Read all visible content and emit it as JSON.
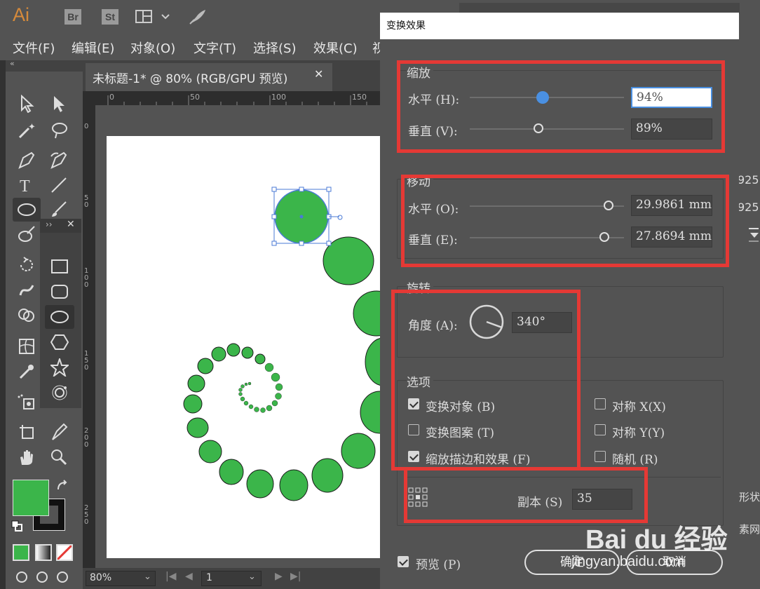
{
  "app": {
    "logo": "Ai",
    "bridge": "Br",
    "stock": "St",
    "menu": [
      "文件(F)",
      "编辑(E)",
      "对象(O)",
      "文字(T)",
      "选择(S)",
      "效果(C)",
      "视"
    ]
  },
  "document": {
    "tab_title": "未标题-1* @ 80% (RGB/GPU 预览)",
    "ruler_h": [
      "0",
      "50",
      "100",
      "150"
    ],
    "ruler_v": [
      "0",
      "50",
      "100",
      "150",
      "200",
      "250"
    ],
    "zoom": "80%",
    "page": "1"
  },
  "dialog": {
    "title": "变换效果",
    "scale": {
      "header": "缩放",
      "h_label": "水平 (H):",
      "h_value": "94%",
      "h_fraction": 0.94,
      "v_label": "垂直 (V):",
      "v_value": "89%",
      "v_fraction": 0.89
    },
    "move": {
      "header": "移动",
      "h_label": "水平 (O):",
      "h_value": "29.9861 mm",
      "v_label": "垂直 (E):",
      "v_value": "27.8694 mm"
    },
    "rotate": {
      "header": "旋转",
      "angle_label": "角度 (A):",
      "angle_value": "340°",
      "angle_deg": 340
    },
    "options": {
      "header": "选项",
      "transform_objects": {
        "label": "变换对象 (B)",
        "checked": true
      },
      "transform_patterns": {
        "label": "变换图案 (T)",
        "checked": false
      },
      "scale_strokes": {
        "label": "缩放描边和效果 (F)",
        "checked": true
      },
      "reflect_x": {
        "label": "对称 X(X)",
        "checked": false
      },
      "reflect_y": {
        "label": "对称 Y(Y)",
        "checked": false
      },
      "random": {
        "label": "随机 (R)",
        "checked": false
      }
    },
    "copies_label": "副本 (S)",
    "copies_value": "35",
    "preview": {
      "label": "预览 (P)",
      "checked": true
    },
    "ok_label": "确定",
    "cancel_label": "取消"
  },
  "right_panel": {
    "val1": "925",
    "val2": "925",
    "shape_label": "形状",
    "grid_label": "素网格"
  },
  "watermark": {
    "brand": "Bai du 经验",
    "url": "jingyan.baidu.com"
  },
  "colors": {
    "fill": "#3bb54a",
    "stroke": "#1a1a1a",
    "highlight": "#e53935",
    "accent": "#4a90e2"
  }
}
